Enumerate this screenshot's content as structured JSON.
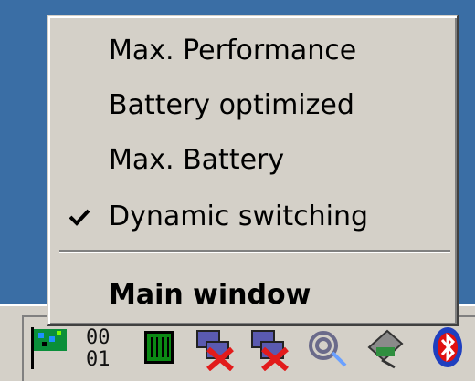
{
  "menu": {
    "items": [
      {
        "label": "Max. Performance",
        "checked": false,
        "bold": false
      },
      {
        "label": "Battery optimized",
        "checked": false,
        "bold": false
      },
      {
        "label": "Max. Battery",
        "checked": false,
        "bold": false
      },
      {
        "label": "Dynamic switching",
        "checked": true,
        "bold": false
      }
    ],
    "main_window": {
      "label": "Main window",
      "bold": true
    }
  },
  "tray": {
    "icons": [
      {
        "name": "network-flag-icon"
      },
      {
        "name": "binary-display-icon"
      },
      {
        "name": "cpu-chip-icon"
      },
      {
        "name": "network-disconnected-icon"
      },
      {
        "name": "network-disconnected-icon"
      },
      {
        "name": "wireless-signal-icon"
      },
      {
        "name": "pc-card-icon"
      },
      {
        "name": "bluetooth-icon"
      }
    ]
  },
  "colors": {
    "desktop": "#3a6ea5",
    "menu_face": "#d4d0c8",
    "text": "#000000"
  }
}
